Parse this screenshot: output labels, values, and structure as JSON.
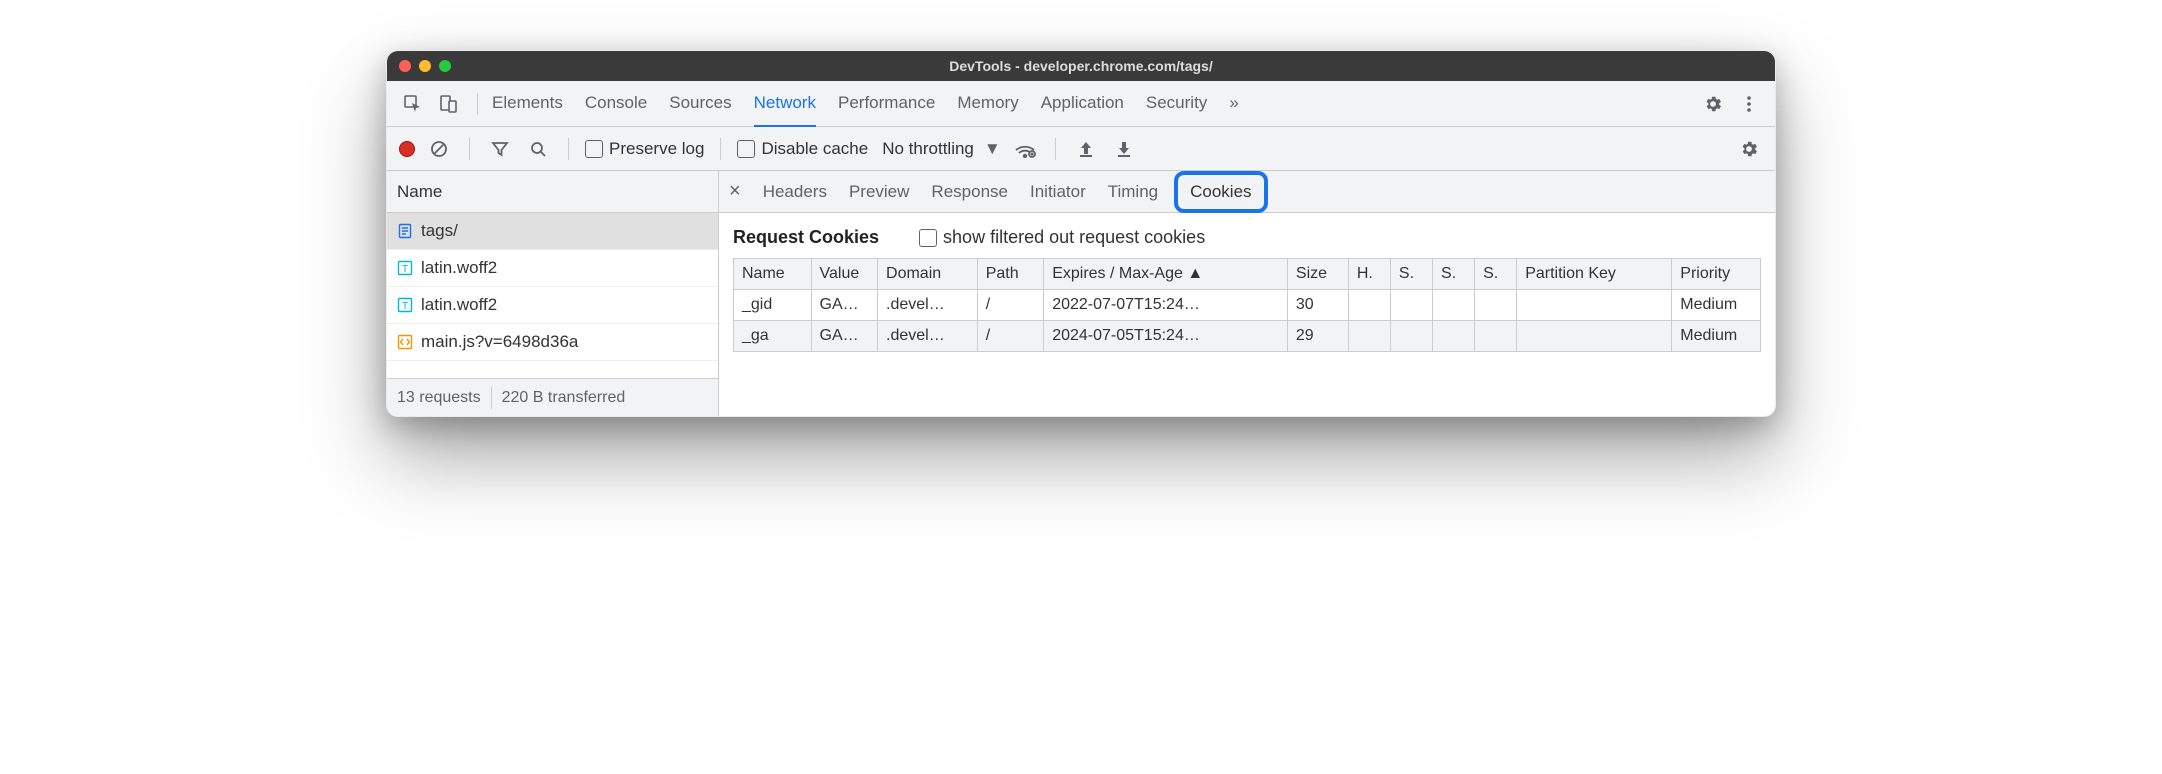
{
  "window": {
    "title": "DevTools - developer.chrome.com/tags/"
  },
  "toolbar_tabs": {
    "elements": "Elements",
    "console": "Console",
    "sources": "Sources",
    "network": "Network",
    "performance": "Performance",
    "memory": "Memory",
    "application": "Application",
    "security": "Security"
  },
  "subbar": {
    "preserve_log": "Preserve log",
    "disable_cache": "Disable cache",
    "throttling": "No throttling"
  },
  "left": {
    "header": "Name",
    "items": [
      {
        "label": "tags/",
        "kind": "doc",
        "selected": true
      },
      {
        "label": "latin.woff2",
        "kind": "font",
        "selected": false
      },
      {
        "label": "latin.woff2",
        "kind": "font",
        "selected": false
      },
      {
        "label": "main.js?v=6498d36a",
        "kind": "js",
        "selected": false
      }
    ],
    "footer": {
      "requests": "13 requests",
      "transferred": "220 B transferred"
    }
  },
  "detail_tabs": {
    "headers": "Headers",
    "preview": "Preview",
    "response": "Response",
    "initiator": "Initiator",
    "timing": "Timing",
    "cookies": "Cookies"
  },
  "cookies": {
    "section_title": "Request Cookies",
    "show_filtered_label": "show filtered out request cookies",
    "columns": {
      "name": "Name",
      "value": "Value",
      "domain": "Domain",
      "path": "Path",
      "expires": "Expires / Max-Age ▲",
      "size": "Size",
      "http_only": "H.",
      "secure": "S.",
      "same_site": "S.",
      "same_party": "S.",
      "partition_key": "Partition Key",
      "priority": "Priority"
    },
    "rows": [
      {
        "name": "_gid",
        "value": "GA…",
        "domain": ".devel…",
        "path": "/",
        "expires": "2022-07-07T15:24…",
        "size": "30",
        "priority": "Medium"
      },
      {
        "name": "_ga",
        "value": "GA…",
        "domain": ".devel…",
        "path": "/",
        "expires": "2024-07-05T15:24…",
        "size": "29",
        "priority": "Medium"
      }
    ]
  }
}
